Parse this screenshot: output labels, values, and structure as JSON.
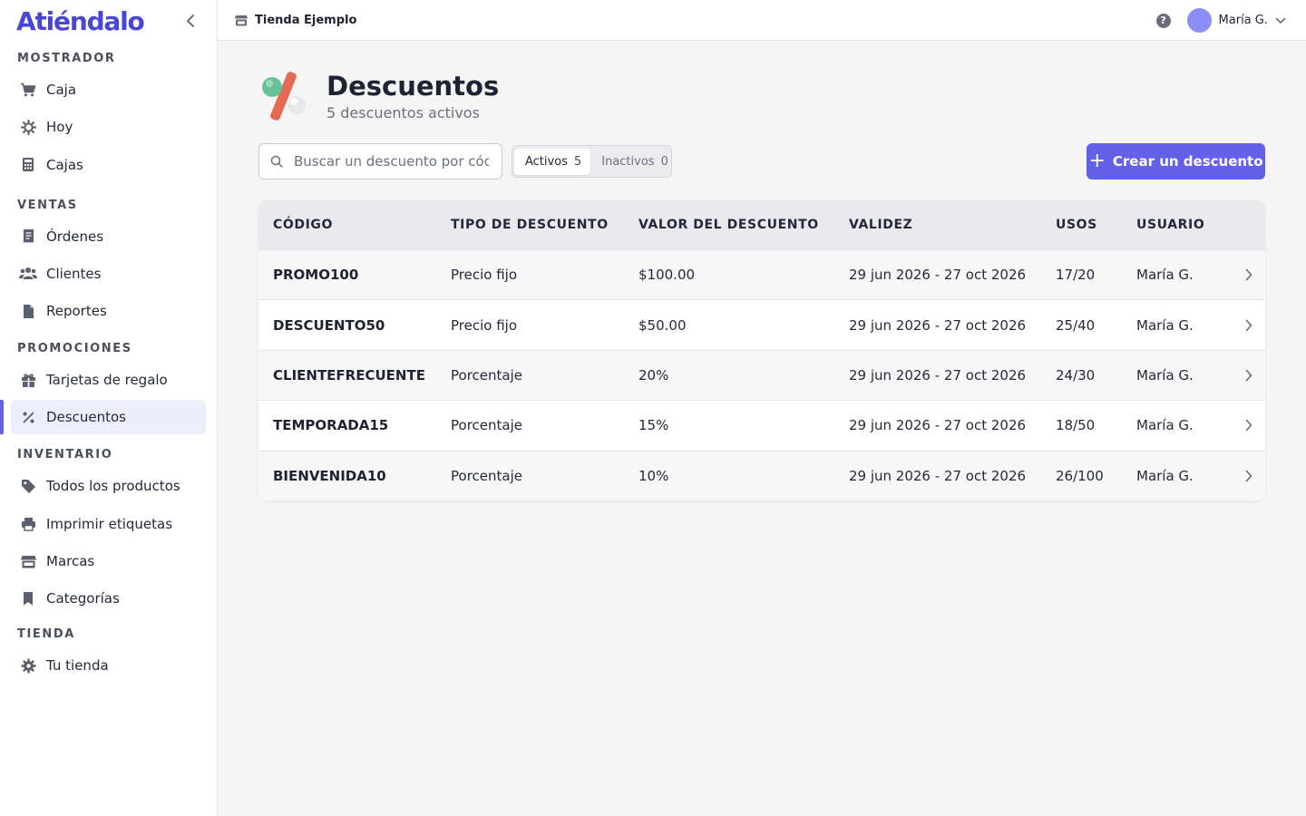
{
  "brand": {
    "logo": "Atiéndalo",
    "accent": "#6560e8",
    "logo_color": "#4a45d9"
  },
  "sidebar": {
    "sections": [
      {
        "title": "MOSTRADOR",
        "items": [
          {
            "label": "Caja",
            "icon": "cart-icon"
          },
          {
            "label": "Hoy",
            "icon": "sun-icon"
          },
          {
            "label": "Cajas",
            "icon": "calculator-icon"
          }
        ]
      },
      {
        "title": "VENTAS",
        "items": [
          {
            "label": "Órdenes",
            "icon": "receipt-icon"
          },
          {
            "label": "Clientes",
            "icon": "users-icon"
          },
          {
            "label": "Reportes",
            "icon": "document-icon"
          }
        ]
      },
      {
        "title": "PROMOCIONES",
        "items": [
          {
            "label": "Tarjetas de regalo",
            "icon": "gift-icon"
          },
          {
            "label": "Descuentos",
            "icon": "percent-icon",
            "active": true
          }
        ]
      },
      {
        "title": "INVENTARIO",
        "items": [
          {
            "label": "Todos los productos",
            "icon": "tag-icon"
          },
          {
            "label": "Imprimir etiquetas",
            "icon": "printer-icon"
          },
          {
            "label": "Marcas",
            "icon": "store-icon"
          },
          {
            "label": "Categorías",
            "icon": "bookmark-icon"
          }
        ]
      },
      {
        "title": "TIENDA",
        "items": [
          {
            "label": "Tu tienda",
            "icon": "gear-icon"
          }
        ]
      }
    ]
  },
  "topbar": {
    "store_name": "Tienda Ejemplo",
    "user_name": "María G."
  },
  "page": {
    "title": "Descuentos",
    "subtitle": "5 descuentos activos"
  },
  "toolbar": {
    "search_placeholder": "Buscar un descuento por código",
    "filters": [
      {
        "label": "Activos",
        "count": "5",
        "selected": true
      },
      {
        "label": "Inactivos",
        "count": "0",
        "selected": false
      }
    ],
    "create_label": "Crear un descuento"
  },
  "table": {
    "columns": [
      "CÓDIGO",
      "TIPO DE DESCUENTO",
      "VALOR DEL DESCUENTO",
      "VALIDEZ",
      "USOS",
      "USUARIO"
    ],
    "rows": [
      {
        "code": "PROMO100",
        "type": "Precio fijo",
        "value": "$100.00",
        "validity": "29 jun 2026 - 27 oct 2026",
        "uses": "17/20",
        "user": "María G."
      },
      {
        "code": "DESCUENTO50",
        "type": "Precio fijo",
        "value": "$50.00",
        "validity": "29 jun 2026 - 27 oct 2026",
        "uses": "25/40",
        "user": "María G."
      },
      {
        "code": "CLIENTEFRECUENTE",
        "type": "Porcentaje",
        "value": "20%",
        "validity": "29 jun 2026 - 27 oct 2026",
        "uses": "24/30",
        "user": "María G."
      },
      {
        "code": "TEMPORADA15",
        "type": "Porcentaje",
        "value": "15%",
        "validity": "29 jun 2026 - 27 oct 2026",
        "uses": "18/50",
        "user": "María G."
      },
      {
        "code": "BIENVENIDA10",
        "type": "Porcentaje",
        "value": "10%",
        "validity": "29 jun 2026 - 27 oct 2026",
        "uses": "26/100",
        "user": "María G."
      }
    ]
  }
}
